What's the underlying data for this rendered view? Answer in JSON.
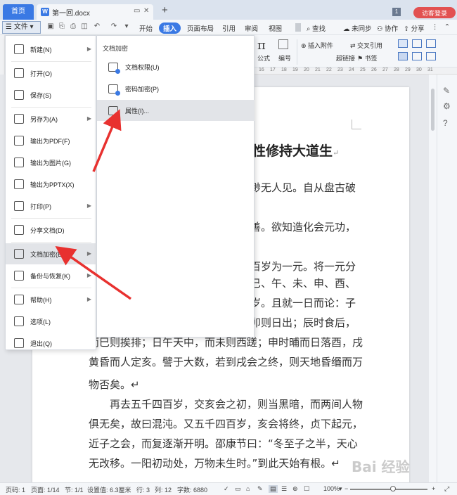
{
  "titlebar": {
    "home_tab": "首页",
    "doc_tab": "第一回.docx",
    "badge": "1",
    "visitor": "访客登录"
  },
  "toolbar": {
    "file_button": "文件",
    "tabs": [
      "开始",
      "插入",
      "页面布局",
      "引用",
      "审阅",
      "视图"
    ],
    "active_tab": "插入",
    "search": "查找",
    "sync": "未同步",
    "collab": "协作",
    "share": "分享"
  },
  "ribbon": {
    "formula": "公式",
    "number": "编号",
    "attach": "插入附件",
    "crossref": "交叉引用",
    "hyperlink": "超链接",
    "bookmark": "书签"
  },
  "ruler_ticks": [
    "16",
    "17",
    "18",
    "19",
    "20",
    "21",
    "22",
    "23",
    "24",
    "25",
    "26",
    "27",
    "28",
    "29",
    "30",
    "31"
  ],
  "file_menu": {
    "items": [
      {
        "label": "新建(N)",
        "icon": "new-doc-icon",
        "arrow": true
      },
      {
        "label": "打开(O)",
        "icon": "folder-icon",
        "arrow": false
      },
      {
        "label": "保存(S)",
        "icon": "save-icon",
        "arrow": false
      },
      {
        "label": "另存为(A)",
        "icon": "save-as-icon",
        "arrow": true
      },
      {
        "label": "输出为PDF(F)",
        "icon": "pdf-icon",
        "arrow": false
      },
      {
        "label": "输出为图片(G)",
        "icon": "image-icon",
        "arrow": false
      },
      {
        "label": "输出为PPTX(X)",
        "icon": "pptx-icon",
        "arrow": false
      },
      {
        "label": "打印(P)",
        "icon": "print-icon",
        "arrow": true
      },
      {
        "label": "分享文档(D)",
        "icon": "share-icon",
        "arrow": false
      },
      {
        "label": "文档加密(E)",
        "icon": "encrypt-icon",
        "arrow": true
      },
      {
        "label": "备份与恢复(K)",
        "icon": "backup-icon",
        "arrow": true
      },
      {
        "label": "帮助(H)",
        "icon": "help-icon",
        "arrow": true
      },
      {
        "label": "选项(L)",
        "icon": "gear-icon",
        "arrow": false
      },
      {
        "label": "退出(Q)",
        "icon": "exit-icon",
        "arrow": false
      }
    ]
  },
  "submenu": {
    "header": "文档加密",
    "items": [
      {
        "label": "文档权限(U)"
      },
      {
        "label": "密码加密(P)"
      },
      {
        "label": "属性(I)..."
      }
    ]
  },
  "document": {
    "title": "性修持大道生",
    "lines": [
      "渺无人见。自从盘古破",
      "善。欲知造化会元功，",
      "百岁为一元。将一元分",
      "巳、午、未、申、酉、",
      "岁。且就一日而论：子",
      "卯则日出；辰时食后，",
      "而巳则挨排；日午天中，而未则西蹉；申时晡而日落酉，戌",
      "黄昏而人定亥。譬于大数，若到戌会之终，则天地昏缗而万",
      "物否矣。↵",
      "　　再去五千四百岁，交亥会之初，则当黑暗，而两间人物",
      "俱无矣，故曰混沌。又五千四百岁，亥会将终，贞下起元，",
      "近子之会，而复逐渐开明。邵康节曰：“冬至子之半，天心",
      "无改移。一阳初动处，万物未生时。”到此天始有根。↵"
    ]
  },
  "status": {
    "page": "页码: 1",
    "pages": "页面: 1/14",
    "section": "节: 1/1",
    "setting": "设置值: 6.3厘米",
    "row": "行: 3",
    "col": "列: 12",
    "words": "字数: 6880",
    "zoom": "100%"
  },
  "watermark": "Bai 经验"
}
